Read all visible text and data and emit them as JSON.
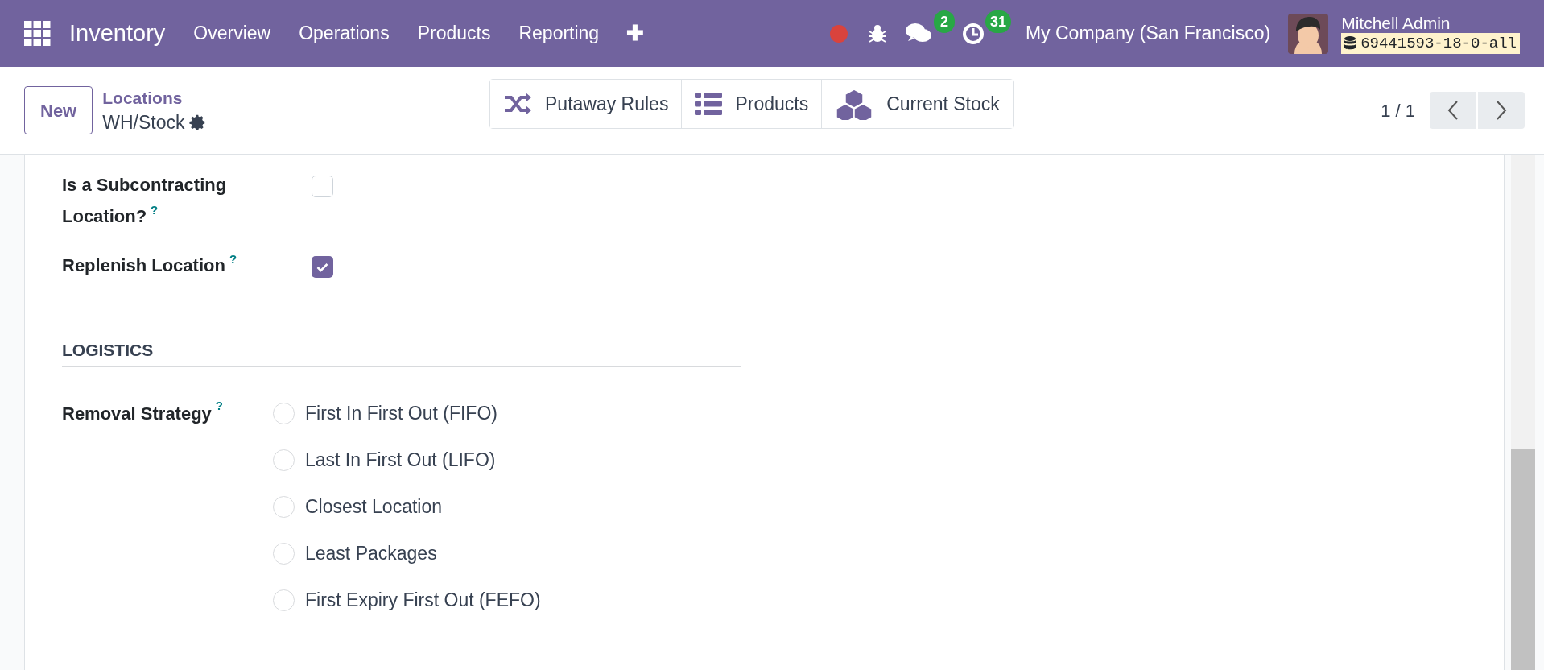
{
  "navbar": {
    "app": "Inventory",
    "menu": [
      "Overview",
      "Operations",
      "Products",
      "Reporting"
    ],
    "plus": "✚",
    "messages_count": "2",
    "activities_count": "31",
    "company": "My Company (San Francisco)",
    "user": "Mitchell Admin",
    "database": "69441593-18-0-all"
  },
  "control_panel": {
    "new_button": "New",
    "breadcrumb": "Locations",
    "record": "WH/Stock",
    "smart_buttons": [
      {
        "kind": "shuffle",
        "label": "Putaway Rules"
      },
      {
        "kind": "list",
        "label": "Products"
      },
      {
        "kind": "cubes",
        "label": "Current Stock"
      }
    ],
    "pager": "1 / 1"
  },
  "form": {
    "checkboxes": [
      {
        "label": "Is a Subcontracting",
        "label_line2": "Location?",
        "help": "?",
        "checked": false
      },
      {
        "label": "Replenish Location",
        "help": "?",
        "checked": true
      }
    ],
    "section": "LOGISTICS",
    "removal": {
      "label": "Removal Strategy",
      "help": "?",
      "options": [
        {
          "label": "First In First Out (FIFO)",
          "selected": false
        },
        {
          "label": "Last In First Out (LIFO)",
          "selected": false
        },
        {
          "label": "Closest Location",
          "selected": false
        },
        {
          "label": "Least Packages",
          "selected": false
        },
        {
          "label": "First Expiry First Out (FEFO)",
          "selected": false
        }
      ]
    }
  }
}
